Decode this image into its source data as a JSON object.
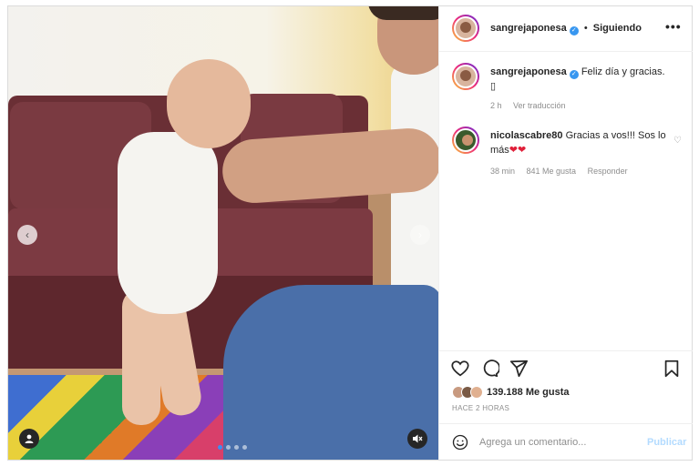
{
  "post": {
    "username": "sangrejaponesa",
    "follow_status": "Siguiendo",
    "separator": "•",
    "more_label": "•••"
  },
  "caption": {
    "username": "sangrejaponesa",
    "text": "Feliz día y gracias.",
    "extra": "▯",
    "time": "2 h",
    "translate": "Ver traducción"
  },
  "comments": [
    {
      "username": "nicolascabre80",
      "text": "Gracias a vos!!! Sos lo más",
      "hearts": "❤❤",
      "time": "38 min",
      "likes": "841 Me gusta",
      "reply": "Responder"
    }
  ],
  "engagement": {
    "likes": "139.188 Me gusta",
    "time_ago": "HACE 2 HORAS"
  },
  "composer": {
    "placeholder": "Agrega un comentario...",
    "publish": "Publicar"
  },
  "media": {
    "prev_icon": "‹",
    "next_icon": "›"
  },
  "colors": {
    "verified": "#3897f0",
    "heart": "#e0203a",
    "publish_disabled": "#b3dbff"
  }
}
